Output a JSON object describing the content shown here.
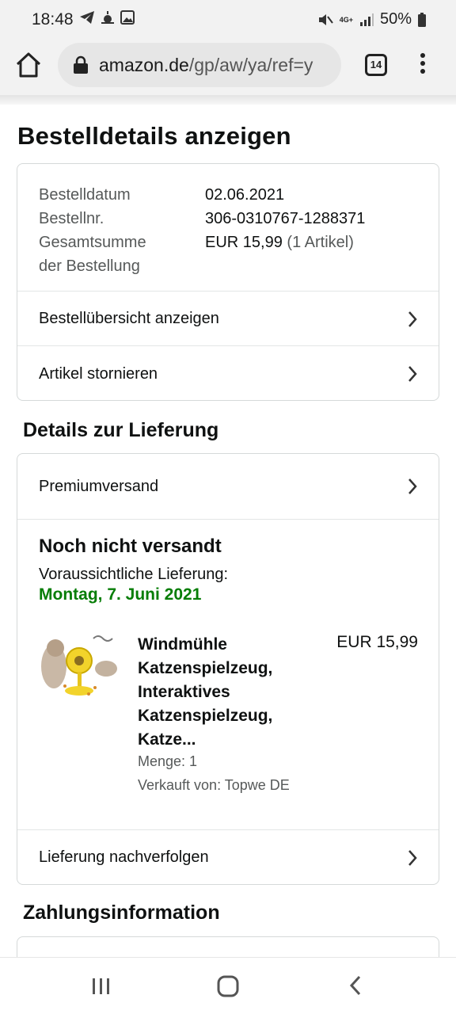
{
  "status_bar": {
    "time": "18:48",
    "network": "4G+",
    "battery": "50%"
  },
  "browser": {
    "url_host": "amazon.de",
    "url_path": "/gp/aw/ya/ref=y",
    "tab_count": "14"
  },
  "page": {
    "title": "Bestelldetails anzeigen"
  },
  "order": {
    "date_label": "Bestelldatum",
    "date_value": "02.06.2021",
    "number_label": "Bestellnr.",
    "number_value": "306-0310767-1288371",
    "total_label_1": "Gesamtsumme",
    "total_label_2": "der Bestellung",
    "total_value": "EUR 15,99",
    "total_count": "(1 Artikel)",
    "links": [
      {
        "label": "Bestellübersicht anzeigen"
      },
      {
        "label": "Artikel stornieren"
      }
    ]
  },
  "delivery": {
    "section_title": "Details zur Lieferung",
    "shipping_method": "Premiumversand",
    "status": "Noch nicht versandt",
    "expected_label": "Voraussichtliche Lieferung:",
    "expected_date": "Montag, 7. Juni 2021",
    "item": {
      "title": "Windmühle Katzenspielzeug, Interaktives Katzenspielzeug, Katze...",
      "price": "EUR 15,99",
      "quantity": "Menge: 1",
      "seller": "Verkauft von: Topwe DE"
    },
    "track_label": "Lieferung nachverfolgen"
  },
  "payment": {
    "section_title": "Zahlungsinformation"
  },
  "colors": {
    "delivery_green": "#067d06",
    "border": "#d5d9d9",
    "muted_text": "#565959"
  }
}
